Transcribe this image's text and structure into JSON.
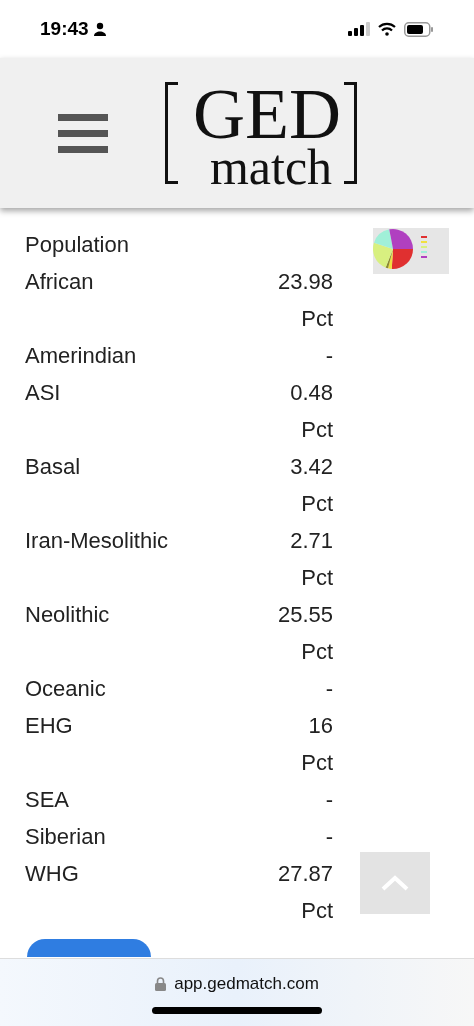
{
  "status_bar": {
    "time": "19:43"
  },
  "header": {
    "logo_top": "GED",
    "logo_bottom": "match"
  },
  "table": {
    "heading": "Population",
    "rows": [
      {
        "name": "African",
        "value": "23.98",
        "unit": "Pct"
      },
      {
        "name": "Amerindian",
        "value": "-"
      },
      {
        "name": "ASI",
        "value": "0.48",
        "unit": "Pct"
      },
      {
        "name": "Basal",
        "value": "3.42",
        "unit": "Pct"
      },
      {
        "name": "Iran-Mesolithic",
        "value": "2.71",
        "unit": "Pct"
      },
      {
        "name": "Neolithic",
        "value": "25.55",
        "unit": "Pct"
      },
      {
        "name": "Oceanic",
        "value": "-"
      },
      {
        "name": "EHG",
        "value": "16",
        "unit": "Pct"
      },
      {
        "name": "SEA",
        "value": "-"
      },
      {
        "name": "Siberian",
        "value": "-"
      },
      {
        "name": "WHG",
        "value": "27.87",
        "unit": "Pct"
      }
    ]
  },
  "oracle_button": {
    "kind": "cut-off"
  },
  "address_bar": {
    "url": "app.gedmatch.com"
  }
}
